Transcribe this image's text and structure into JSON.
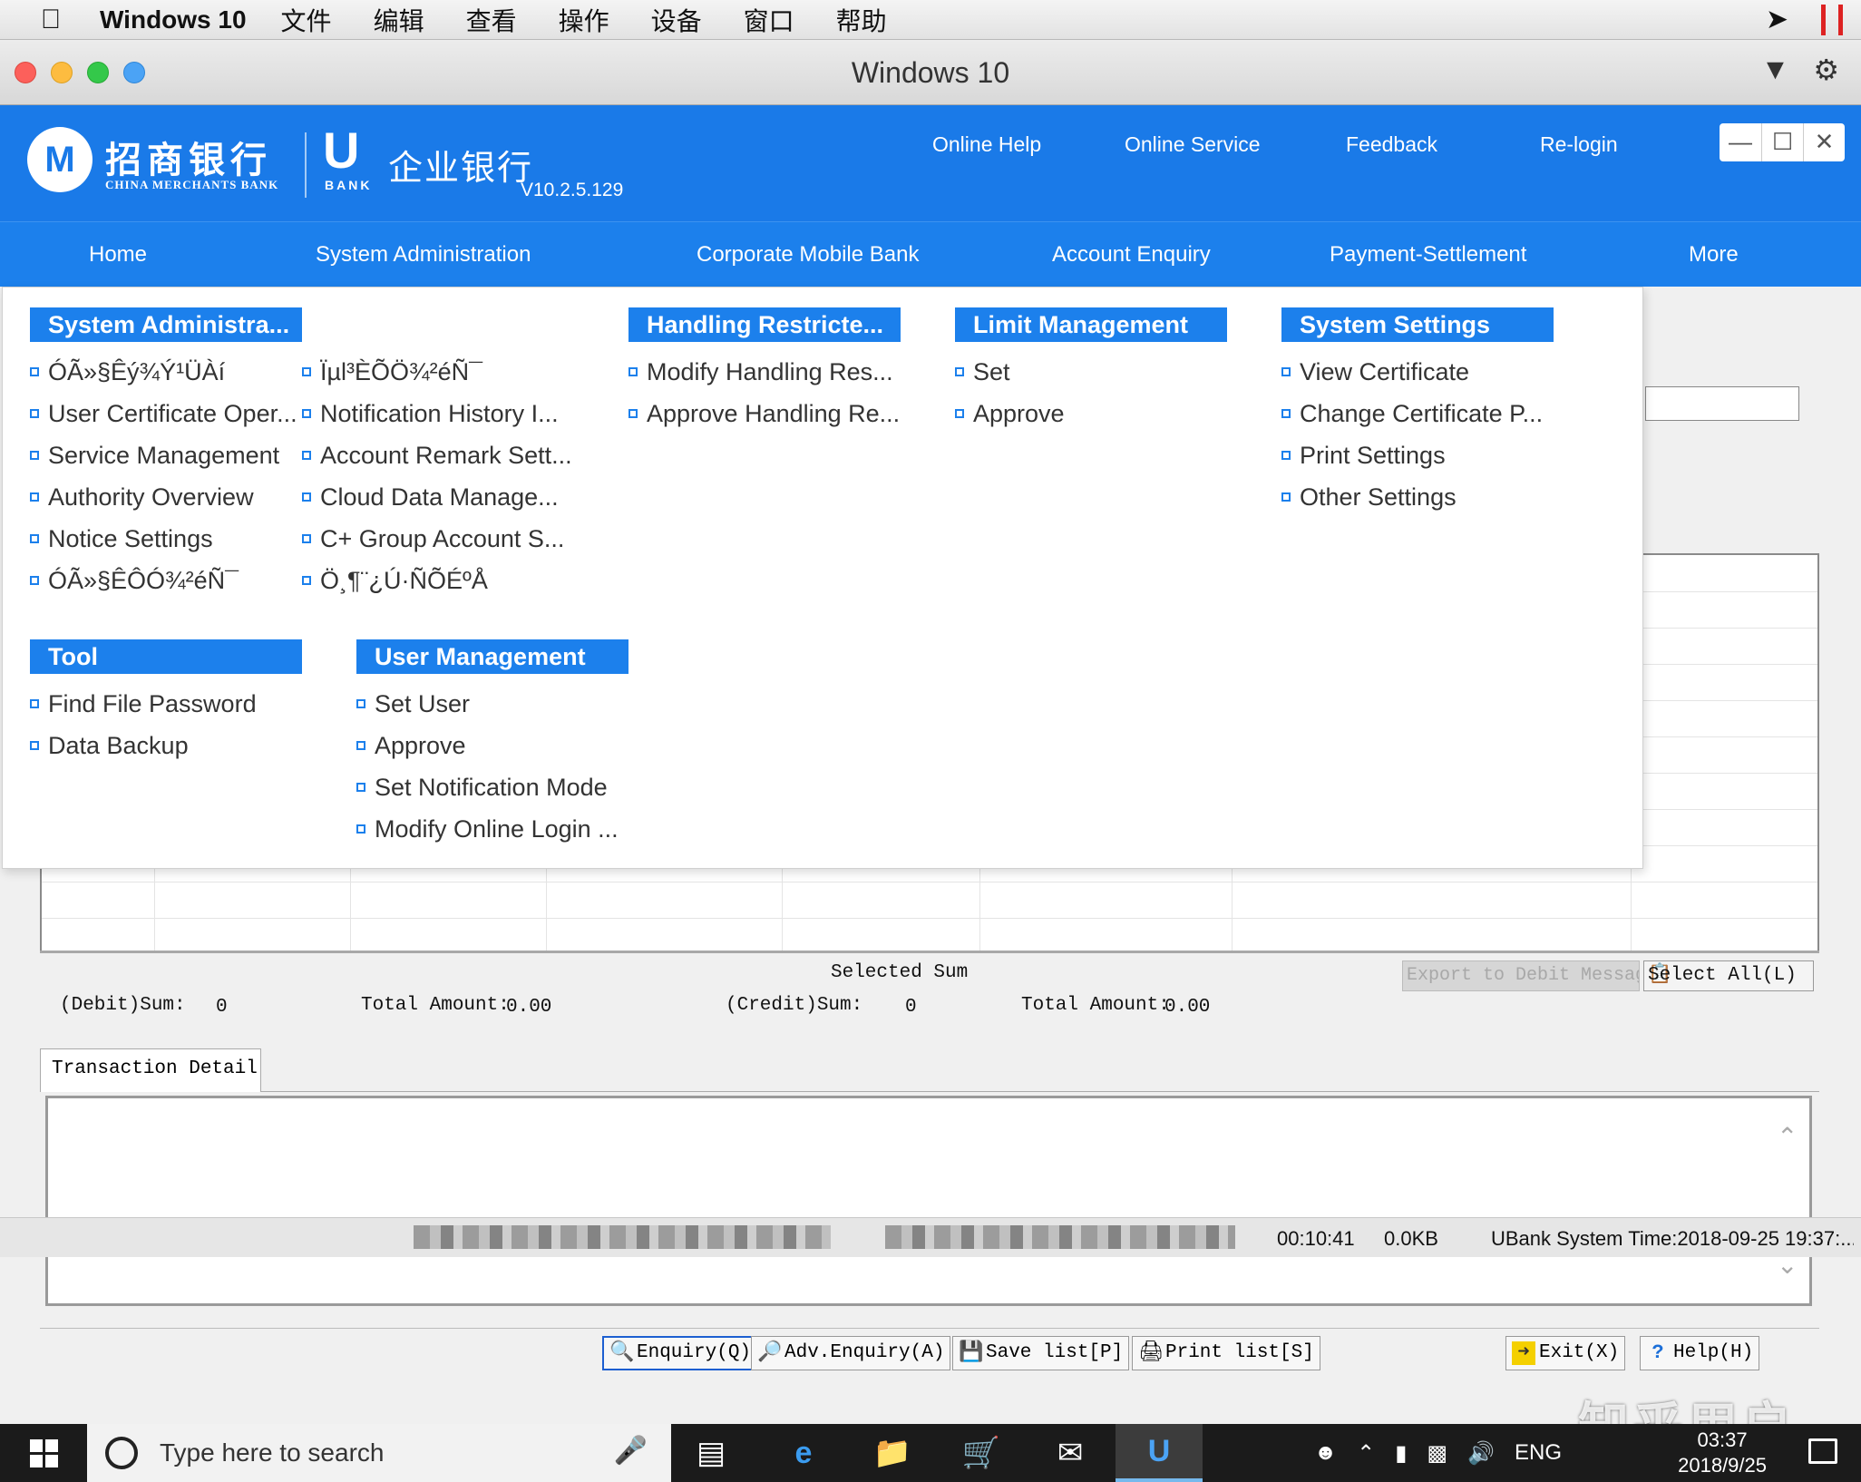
{
  "mac_menubar": {
    "app_name": "Windows 10",
    "items": [
      "文件",
      "编辑",
      "查看",
      "操作",
      "设备",
      "窗口",
      "帮助"
    ]
  },
  "vm_window": {
    "title": "Windows 10"
  },
  "app_header": {
    "bank_name_cn": "招商银行",
    "bank_name_en": "CHINA MERCHANTS BANK",
    "ubank_label": "BANK",
    "product_name": "企业银行",
    "version": "V10.2.5.129",
    "links": [
      "Online Help",
      "Online Service",
      "Feedback",
      "Re-login"
    ],
    "accent_color": "#1a7ae8"
  },
  "nav": {
    "items": [
      "Home",
      "System Administration",
      "Corporate Mobile Bank",
      "Account Enquiry",
      "Payment-Settlement",
      "More"
    ]
  },
  "mega_menu": {
    "system_admin": {
      "title": "System Administra...",
      "col1": [
        "ÓÃ»§Êý¾Ý¹ÜÀí",
        "User Certificate Oper...",
        "Service Management",
        "Authority Overview",
        "Notice Settings",
        "ÓÃ»§ÊÔÓ¾²éÑ¯"
      ],
      "col2": [
        "Ïµl³ÈÕÖ¾²éÑ¯",
        "Notification History I...",
        "Account Remark Sett...",
        "Cloud Data Manage...",
        "C+ Group Account S...",
        "Ö¸¶¨¿Ú·ÑÕÉºÅ"
      ]
    },
    "handling": {
      "title": "Handling Restricte...",
      "items": [
        "Modify Handling Res...",
        "Approve Handling Re..."
      ]
    },
    "limit": {
      "title": "Limit Management",
      "items": [
        "Set",
        "Approve"
      ]
    },
    "system_settings": {
      "title": "System Settings",
      "items": [
        "View Certificate",
        "Change Certificate P...",
        "Print Settings",
        "Other Settings"
      ]
    },
    "tool": {
      "title": "Tool",
      "items": [
        "Find File Password",
        "Data Backup"
      ]
    },
    "user_mgmt": {
      "title": "User Management",
      "items": [
        "Set User",
        "Approve",
        "Set Notification Mode",
        "Modify Online Login ..."
      ]
    }
  },
  "summary": {
    "selected_sum": "Selected Sum",
    "debit_label": "(Debit)Sum:",
    "debit_count": "0",
    "debit_total_label": "Total Amount:",
    "debit_total": "0.00",
    "credit_label": "(Credit)Sum:",
    "credit_count": "0",
    "credit_total_label": "Total Amount:",
    "credit_total": "0.00",
    "export_button": "Export to Debit Messag",
    "select_all_button": "Select All(L)"
  },
  "detail_tab": "Transaction Detail",
  "bottom_toolbar": {
    "enquiry": "Enquiry(Q)",
    "adv_enquiry": "Adv.Enquiry(A)",
    "save_list": "Save list[P]",
    "print_list": "Print list[S]",
    "exit": "Exit(X)",
    "help": "Help(H)"
  },
  "status_bar": {
    "elapsed": "00:10:41",
    "size": "0.0KB",
    "system_time": "UBank System Time:2018-09-25 19:37:..."
  },
  "taskbar": {
    "search_placeholder": "Type here to search",
    "language": "ENG",
    "time": "03:37",
    "date": "2018/9/25"
  },
  "watermark": "知乎用户"
}
